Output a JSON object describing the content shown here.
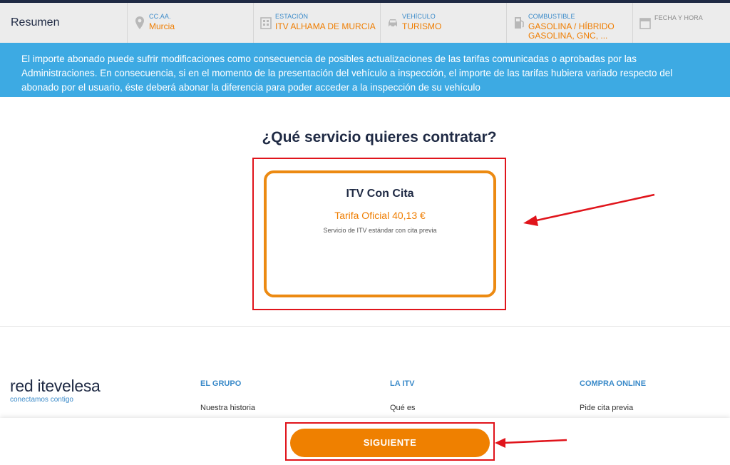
{
  "summary": {
    "title": "Resumen",
    "items": [
      {
        "label": "CC.AA.",
        "value": "Murcia",
        "icon": "location-pin-icon"
      },
      {
        "label": "ESTACIÓN",
        "value": "ITV ALHAMA DE MURCIA",
        "icon": "building-icon"
      },
      {
        "label": "VEHÍCULO",
        "value": "TURISMO",
        "icon": "car-icon"
      },
      {
        "label": "COMBUSTIBLE",
        "value": "GASOLINA / HÍBRIDO GASOLINA, GNC, ...",
        "icon": "fuel-pump-icon"
      },
      {
        "label": "FECHA Y HORA",
        "value": "",
        "icon": "calendar-icon"
      }
    ]
  },
  "banner": {
    "text": "El importe abonado puede sufrir modificaciones como consecuencia de posibles actualizaciones de las tarifas comunicadas o aprobadas por las Administraciones. En consecuencia, si en el momento de la presentación del vehículo a inspección, el importe de las tarifas hubiera variado respecto del abonado por el usuario, éste deberá abonar la diferencia para poder acceder a la inspección de su vehículo"
  },
  "main": {
    "question": "¿Qué servicio quieres contratar?",
    "service": {
      "name": "ITV Con Cita",
      "price": "Tarifa Oficial 40,13 €",
      "description": "Servicio de ITV estándar con cita previa"
    }
  },
  "footer": {
    "brand_a": "red ",
    "brand_b": "itevelesa",
    "tagline": "conectamos contigo",
    "columns": [
      {
        "title": "EL GRUPO",
        "first_link": "Nuestra historia"
      },
      {
        "title": "LA ITV",
        "first_link": "Qué es"
      },
      {
        "title": "COMPRA ONLINE",
        "first_link": "Pide cita previa"
      }
    ]
  },
  "actions": {
    "next_label": "SIGUIENTE"
  },
  "colors": {
    "accent": "#ef8000",
    "banner": "#3daae3",
    "annotation_red": "#e0141b",
    "navy": "#1f2a44"
  }
}
